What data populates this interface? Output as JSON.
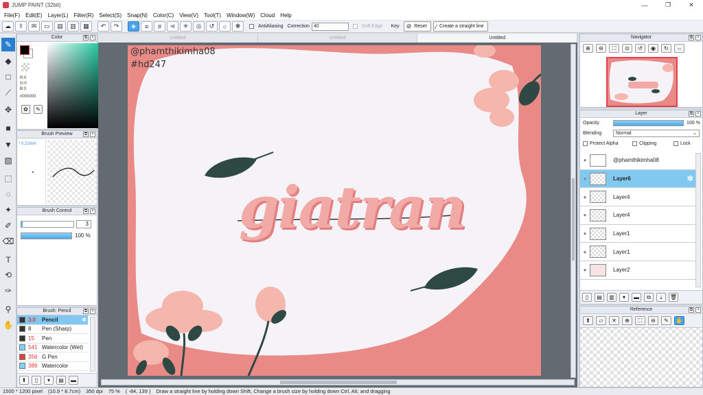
{
  "window": {
    "title": "JUMP PAINT (32bit)",
    "controls": [
      "—",
      "❐",
      "✕"
    ]
  },
  "menu": [
    "File(F)",
    "Edit(E)",
    "Layer(L)",
    "Filter(R)",
    "Select(S)",
    "Snap(N)",
    "Color(C)",
    "View(V)",
    "Tool(T)",
    "Window(W)",
    "Cloud",
    "Help"
  ],
  "toolbar": {
    "antialiasing_label": "AntiAliasing",
    "correction_label": "Correction",
    "correction_value": "40",
    "soft_edge_label": "Soft Edge",
    "key_label": "Key",
    "reset_label": "Reset",
    "straight_line_label": "Create a straight line"
  },
  "color_panel": {
    "title": "Color",
    "r": "R:0",
    "g": "G:0",
    "b": "B:0",
    "hex": "#000000",
    "fg": "#000000",
    "bg": "#ffffff"
  },
  "brush_preview": {
    "title": "Brush Preview",
    "size": "* 0.22mm"
  },
  "brush_control": {
    "title": "Brush Control",
    "size": "3",
    "opacity": "100 %",
    "size_level": 0.03,
    "opacity_level": 1.0
  },
  "brush_list": {
    "title": "Brush: Pencil",
    "items": [
      {
        "size": "3.0",
        "name": "Pencil",
        "color": "#333333"
      },
      {
        "size": "8",
        "name": "Pen (Sharp)",
        "color": "#333333"
      },
      {
        "size": "15",
        "name": "Pen",
        "color": "#333333"
      },
      {
        "size": "541",
        "name": "Watercolor (Wet)",
        "color": "#7ed2f2"
      },
      {
        "size": "356",
        "name": "G Pen",
        "color": "#e04040"
      },
      {
        "size": "389",
        "name": "Watercolor",
        "color": "#7ed2f2"
      }
    ]
  },
  "documents": {
    "tabs": [
      "Untitled",
      "Untitled",
      "Untitled"
    ]
  },
  "artwork": {
    "watermark_line1": "@phamthikimha08",
    "watermark_line2": "#hd247",
    "script_text": "giatran"
  },
  "navigator": {
    "title": "Navigator"
  },
  "layer_panel": {
    "title": "Layer",
    "opacity_label": "Opacity",
    "opacity_value": "100 %",
    "opacity_level": 1.0,
    "blending_label": "Blending",
    "blending_value": "Normal",
    "protect_alpha": "Protect Alpha",
    "clipping": "Clipping",
    "lock": "Lock",
    "layers": [
      "@phamthikimha08",
      "Layer6",
      "Layer4",
      "Layer4",
      "Layer1",
      "Layer1",
      "Layer2"
    ]
  },
  "reference": {
    "title": "Reference"
  },
  "status": {
    "size": "1500 * 1200 pixel",
    "physical": "(10.9 * 8.7cm)",
    "dpi": "350 dpi",
    "zoom": "75 %",
    "coords": "( -84, 139 )",
    "hint": "Draw a straight line by holding down Shift, Change a brush size by holding down Ctrl, Alt, and dragging"
  },
  "colors": {
    "accent": "#2a7fd0",
    "selection": "#82c9f1",
    "pink": "#e98a87",
    "cream": "#f5f3f8",
    "petal": "#f4b6ad",
    "leaf": "#2e4943"
  }
}
